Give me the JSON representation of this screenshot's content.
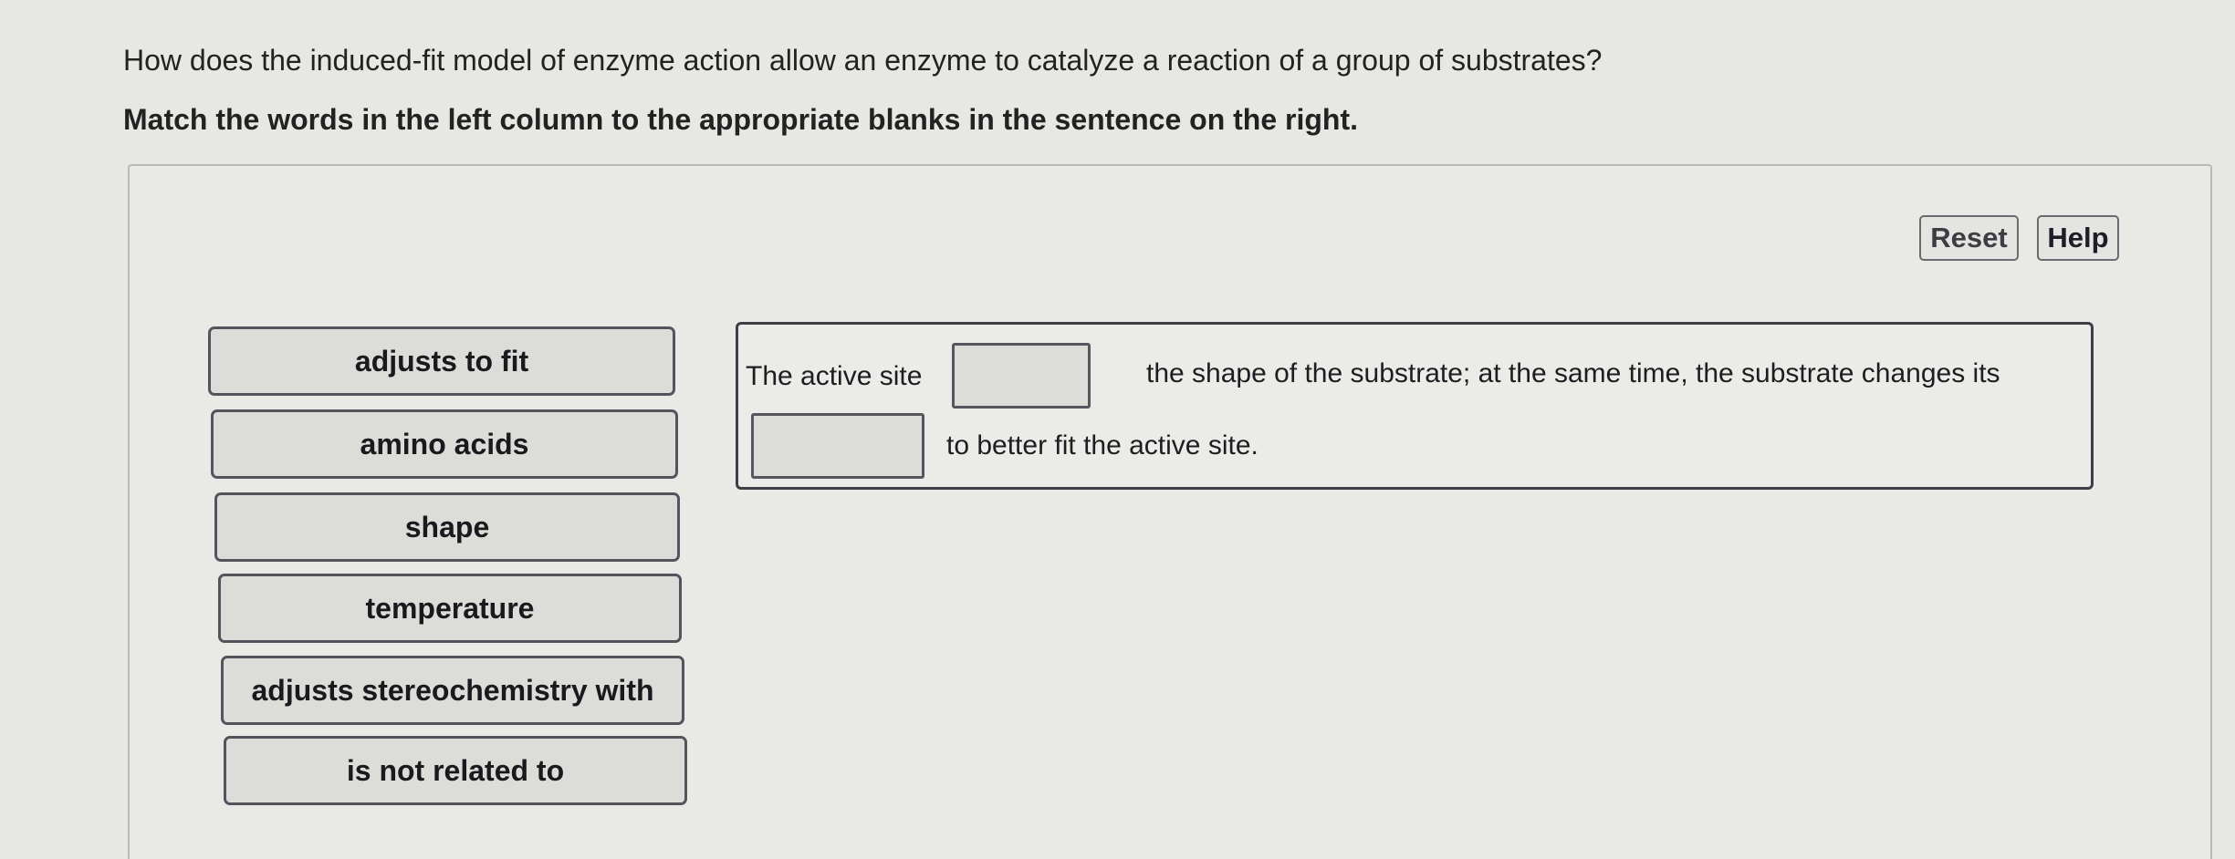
{
  "question": {
    "title": "How does the induced-fit model of enzyme action allow an enzyme to catalyze a reaction of a group of substrates?",
    "instruction": "Match the words in the left column to the appropriate blanks in the sentence on the right."
  },
  "toolbar": {
    "reset_label": "Reset",
    "help_label": "Help"
  },
  "word_bank": [
    {
      "label": "adjusts to fit"
    },
    {
      "label": "amino acids"
    },
    {
      "label": "shape"
    },
    {
      "label": "temperature"
    },
    {
      "label": "adjusts stereochemistry with"
    },
    {
      "label": "is not related to"
    }
  ],
  "sentence": {
    "part1": "The active site",
    "blank1_value": "",
    "part2": "the shape of the substrate; at the same time, the substrate changes its",
    "blank2_value": "",
    "part3": "to better fit the active site."
  }
}
